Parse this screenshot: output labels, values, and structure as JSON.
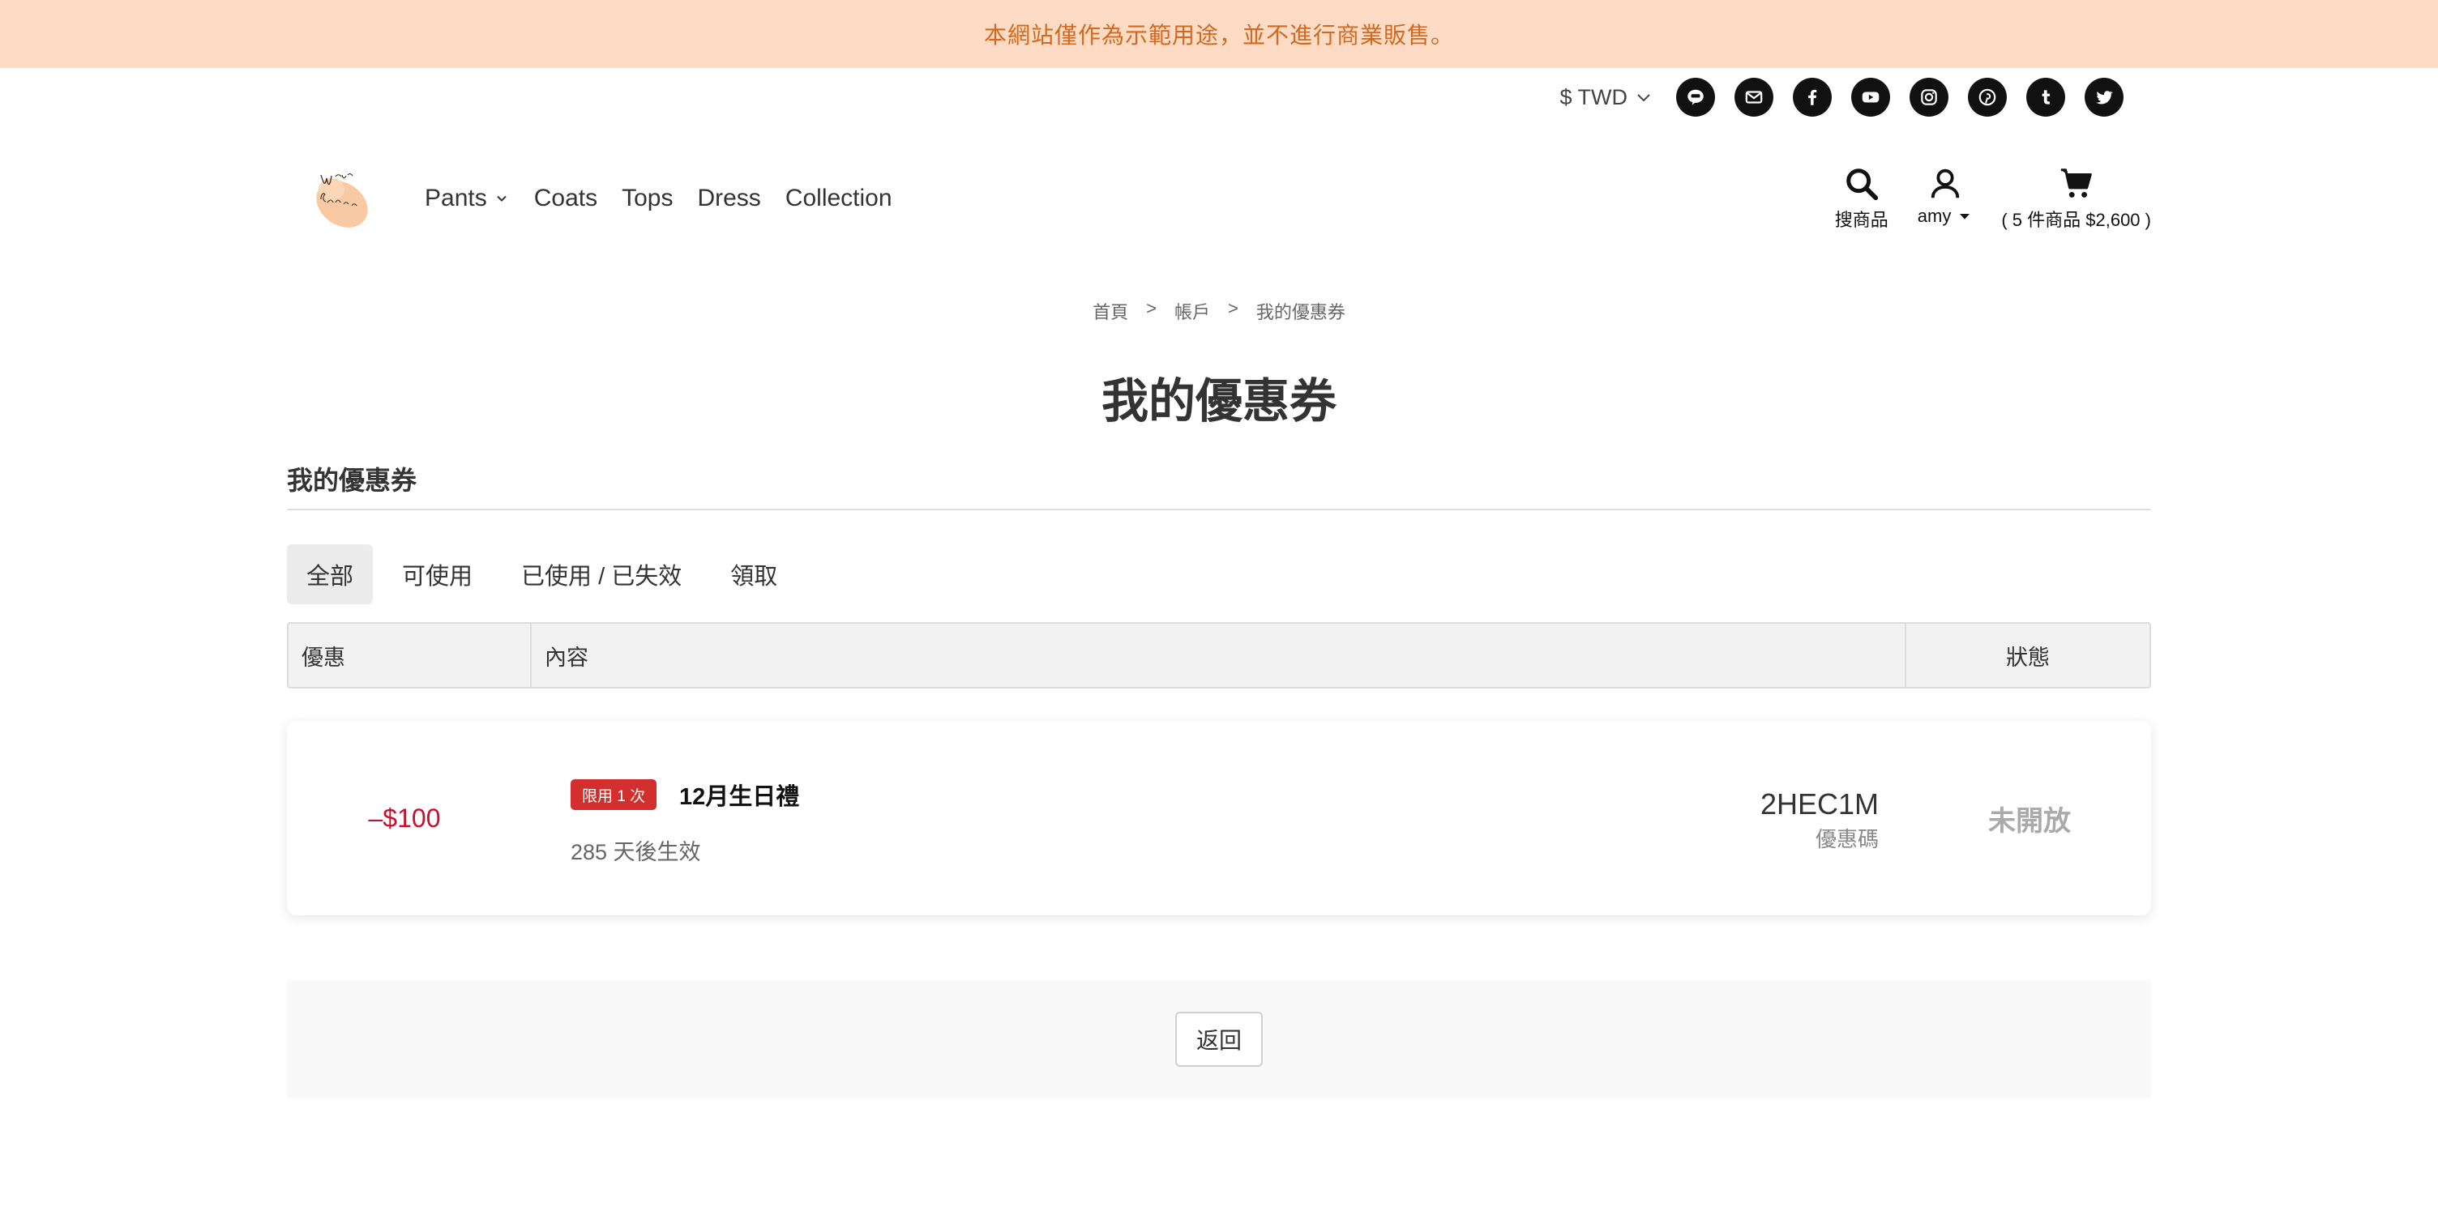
{
  "announcement": "本網站僅作為示範用途，並不進行商業販售。",
  "currency": {
    "label": "$ TWD",
    "icon": "chevron-down-icon"
  },
  "social_icons": [
    "line-icon",
    "email-icon",
    "facebook-icon",
    "youtube-icon",
    "instagram-icon",
    "pinterest-icon",
    "tumblr-icon",
    "twitter-icon"
  ],
  "nav": {
    "items": [
      {
        "label": "Pants",
        "has_dropdown": true
      },
      {
        "label": "Coats"
      },
      {
        "label": "Tops"
      },
      {
        "label": "Dress"
      },
      {
        "label": "Collection"
      }
    ]
  },
  "tools": {
    "search_label": "搜商品",
    "account_label": "amy",
    "cart_label": "( 5 件商品 $2,600 )"
  },
  "breadcrumb": [
    "首頁",
    "帳戶",
    "我的優惠券"
  ],
  "breadcrumb_sep": ">",
  "page_title": "我的優惠券",
  "section_title": "我的優惠券",
  "tabs": [
    {
      "label": "全部",
      "active": true
    },
    {
      "label": "可使用"
    },
    {
      "label": "已使用 / 已失效"
    },
    {
      "label": "領取"
    }
  ],
  "table": {
    "headers": [
      "優惠",
      "內容",
      "狀態"
    ]
  },
  "coupon": {
    "amount": "–$100",
    "badge": "限用 1 次",
    "name": "12月生日禮",
    "effective": "285 天後生效",
    "code": "2HEC1M",
    "code_label": "優惠碼",
    "status": "未開放"
  },
  "back_label": "返回",
  "colors": {
    "announcement_bg": "#fddbc4",
    "announcement_text": "#d2691e",
    "discount_red": "#c8102e",
    "badge_red": "#d32f2f"
  }
}
